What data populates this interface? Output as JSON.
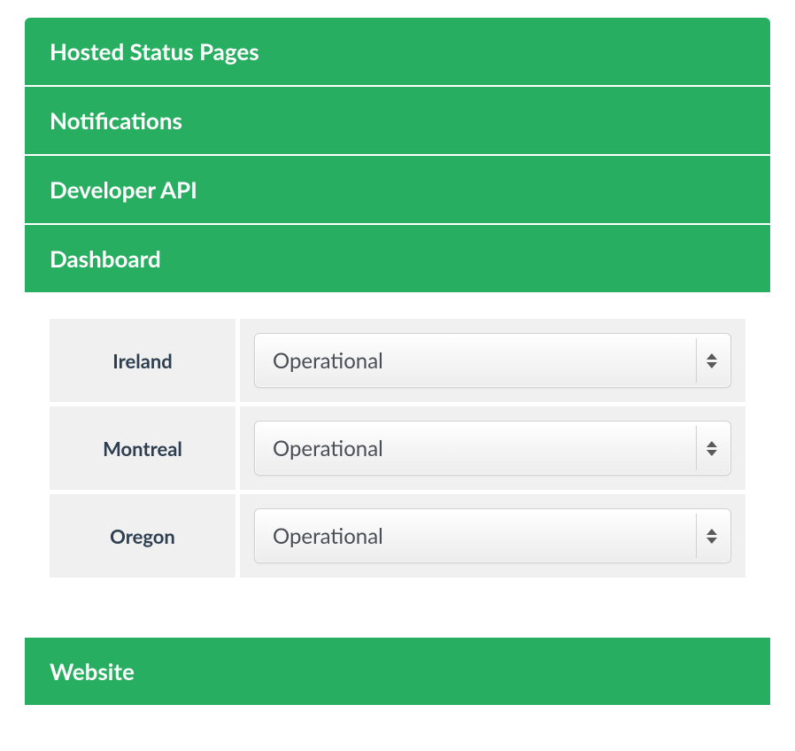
{
  "colors": {
    "accent": "#27ae60",
    "text_dark": "#2c3e50",
    "cell_bg": "#f0f0f0"
  },
  "sections": {
    "hosted_status_pages": {
      "label": "Hosted Status Pages"
    },
    "notifications": {
      "label": "Notifications"
    },
    "developer_api": {
      "label": "Developer API"
    },
    "dashboard": {
      "label": "Dashboard"
    },
    "website": {
      "label": "Website"
    }
  },
  "dashboard_rows": [
    {
      "region": "Ireland",
      "status": "Operational"
    },
    {
      "region": "Montreal",
      "status": "Operational"
    },
    {
      "region": "Oregon",
      "status": "Operational"
    }
  ]
}
